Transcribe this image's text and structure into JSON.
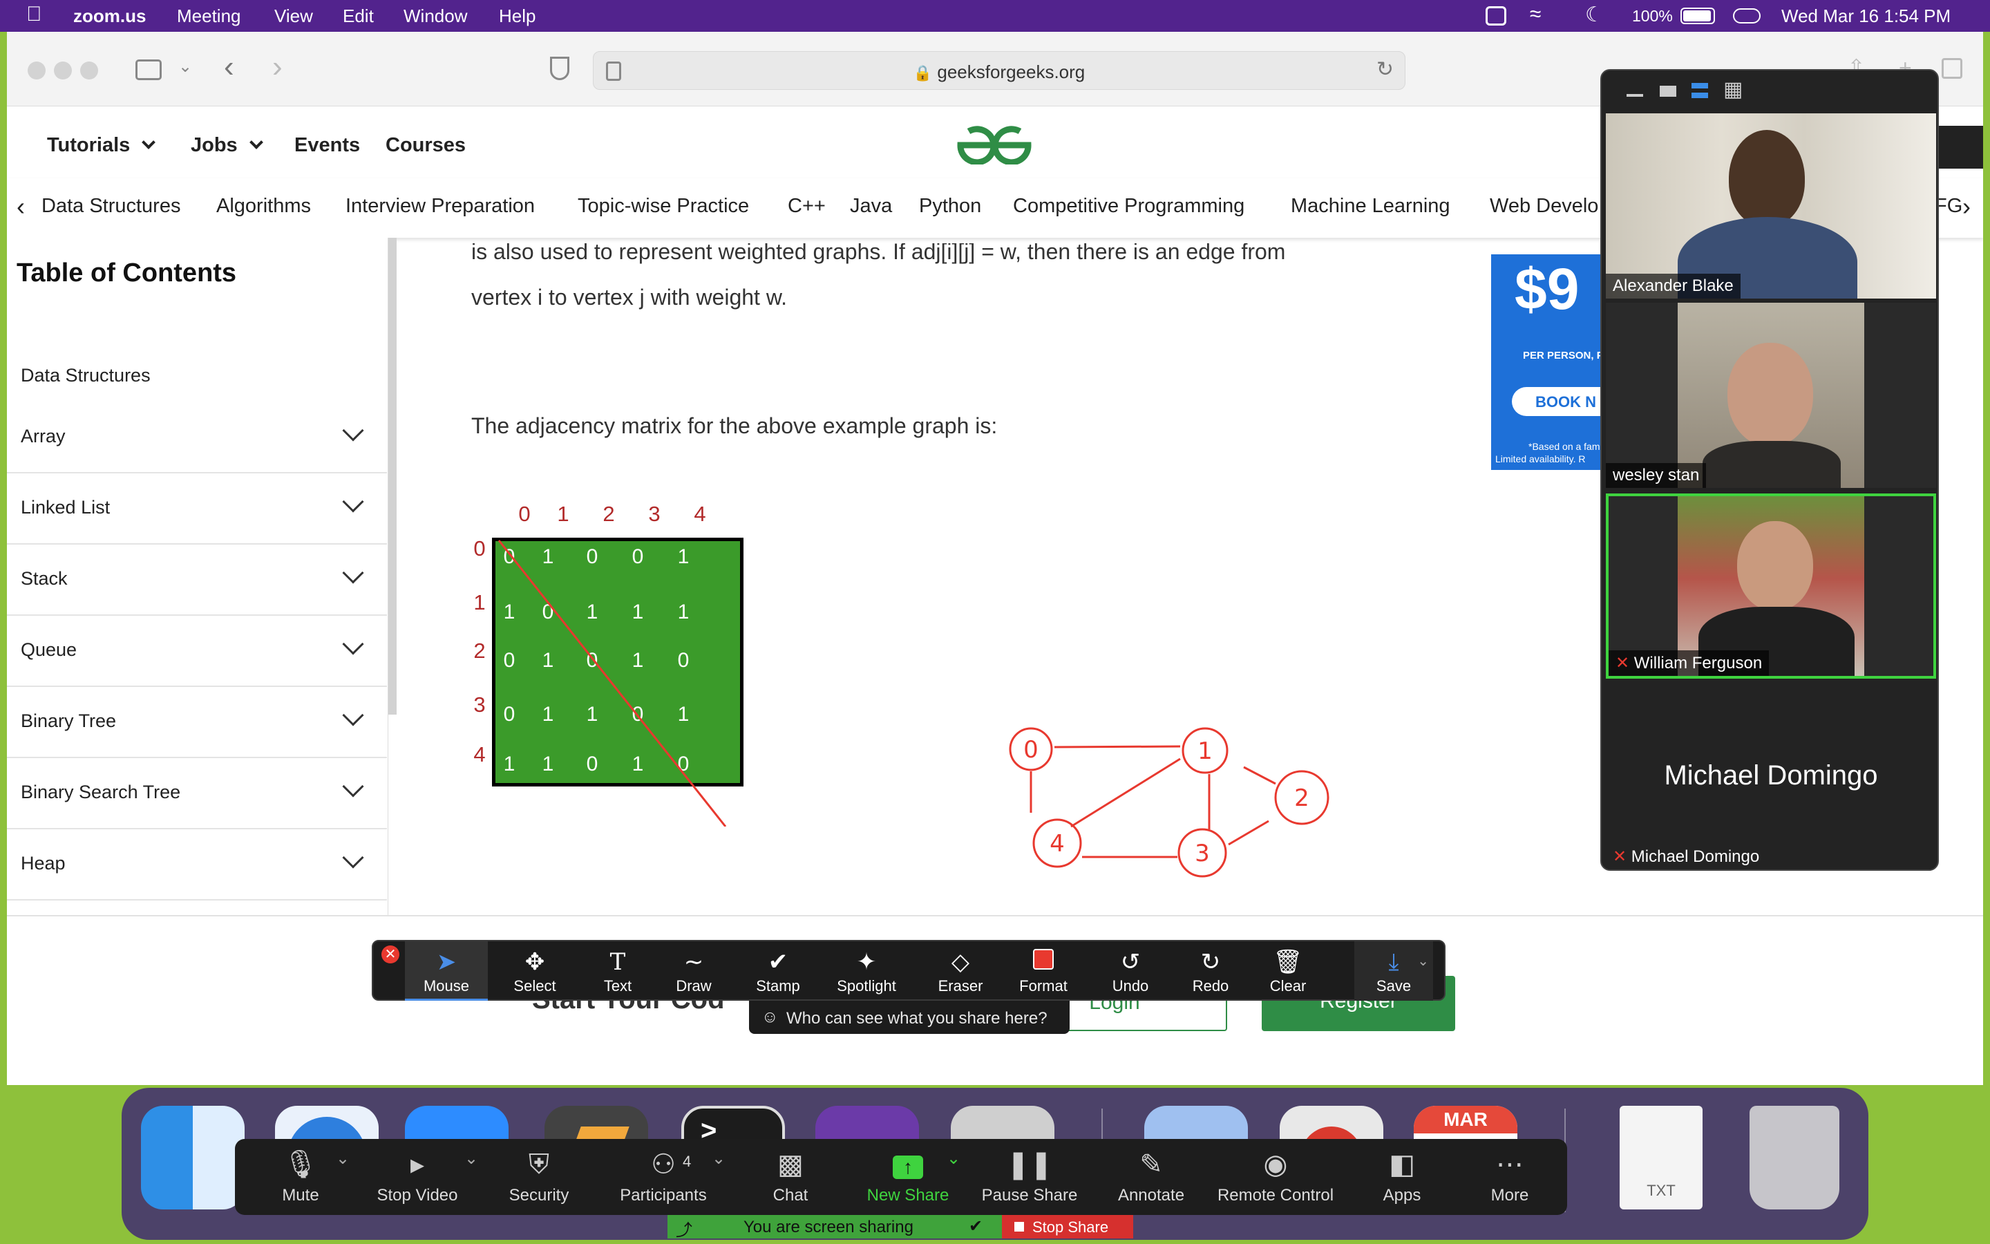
{
  "menubar": {
    "app": "zoom.us",
    "items": [
      "Meeting",
      "View",
      "Edit",
      "Window",
      "Help"
    ],
    "battery": "100%",
    "datetime": "Wed Mar 16  1:54 PM"
  },
  "browser": {
    "url": "geeksforgeeks.org"
  },
  "gfg": {
    "nav": [
      "Tutorials",
      "Jobs",
      "Events",
      "Courses"
    ],
    "subnav": [
      "Data Structures",
      "Algorithms",
      "Interview Preparation",
      "Topic-wise Practice",
      "C++",
      "Java",
      "Python",
      "Competitive Programming",
      "Machine Learning",
      "Web Develo"
    ],
    "subnav_overflow": "FG"
  },
  "toc": {
    "title": "Table of Contents",
    "first": "Data Structures",
    "items": [
      "Array",
      "Linked List",
      "Stack",
      "Queue",
      "Binary Tree",
      "Binary Search Tree",
      "Heap"
    ]
  },
  "article": {
    "line1": "is also used to represent weighted graphs. If adj[i][j] = w, then there is an edge from",
    "line2": "vertex i to vertex j with weight w.",
    "line3": "The adjacency matrix for the above example graph is:"
  },
  "ad": {
    "price": "$9",
    "sub": "PER PERSON, P",
    "book": "BOOK N",
    "fine1": "*Based on a fam",
    "fine2": "Limited availability. R"
  },
  "matrix": {
    "headers": [
      "0",
      "1",
      "2",
      "3",
      "4"
    ],
    "rows": [
      [
        "0",
        "1",
        "0",
        "0",
        "1"
      ],
      [
        "1",
        "0",
        "1",
        "1",
        "1"
      ],
      [
        "0",
        "1",
        "0",
        "1",
        "0"
      ],
      [
        "0",
        "1",
        "1",
        "0",
        "1"
      ],
      [
        "1",
        "1",
        "0",
        "1",
        "0"
      ]
    ]
  },
  "graph": {
    "nodes": [
      "0",
      "1",
      "2",
      "3",
      "4"
    ]
  },
  "footer": {
    "cta": "Start Your Cod",
    "login": "Login",
    "register": "Register"
  },
  "participants": [
    {
      "name": "Alexander Blake",
      "muted": false
    },
    {
      "name": "wesley stan",
      "muted": false
    },
    {
      "name": "William Ferguson",
      "muted": true
    },
    {
      "name": "Michael Domingo",
      "muted": true,
      "display": "Michael Domingo"
    }
  ],
  "annotate": {
    "tools": [
      "Mouse",
      "Select",
      "Text",
      "Draw",
      "Stamp",
      "Spotlight",
      "Eraser",
      "Format",
      "Undo",
      "Redo",
      "Clear",
      "Save"
    ],
    "who_sees": "Who can see what you share here?"
  },
  "dock": {
    "calendar_month": "MAR",
    "txt_label": "TXT"
  },
  "zoombar": {
    "controls": [
      "Mute",
      "Stop Video",
      "Security",
      "Participants",
      "Chat",
      "New Share",
      "Pause Share",
      "Annotate",
      "Remote Control",
      "Apps",
      "More"
    ],
    "participant_count": "4",
    "sharing": "You are screen sharing",
    "stop_share": "Stop Share"
  },
  "colors": {
    "gfg_green": "#2f8d46",
    "matrix_green": "#3b9b2a",
    "zoom_menu": "#52238d",
    "share_green": "#3fa33b",
    "stop_red": "#d6302e",
    "annotation_red": "#e8392f"
  }
}
